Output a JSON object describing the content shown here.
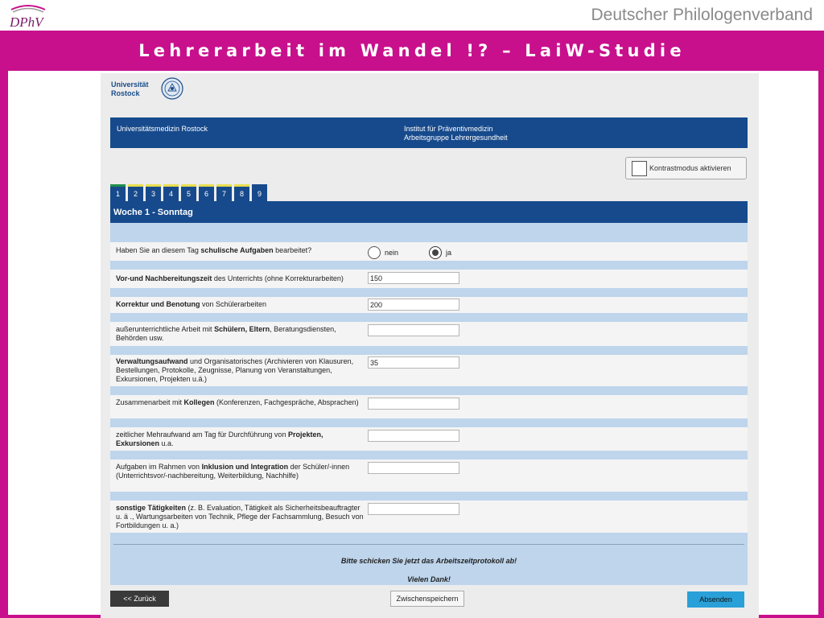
{
  "slide": {
    "logo_text": "DPhV",
    "org_name": "Deutscher Philologenverband",
    "title": "Lehrerarbeit im Wandel !? – LaiW-Studie",
    "colors": {
      "frame": "#c8108c",
      "navy": "#174a8c",
      "band": "#bed5ec",
      "send": "#2aa0d8"
    }
  },
  "header": {
    "university_line1": "Universität",
    "university_line2": "Rostock",
    "bar_left": "Universitätsmedizin Rostock",
    "bar_right_line1": "Institut für Präventivmedizin",
    "bar_right_line2": "Arbeitsgruppe Lehrergesundheit"
  },
  "contrast": {
    "label": "Kontrastmodus aktivieren"
  },
  "tabs": [
    {
      "label": "1",
      "state": "done"
    },
    {
      "label": "2",
      "state": "pending"
    },
    {
      "label": "3",
      "state": "pending"
    },
    {
      "label": "4",
      "state": "pending"
    },
    {
      "label": "5",
      "state": "pending"
    },
    {
      "label": "6",
      "state": "pending"
    },
    {
      "label": "7",
      "state": "pending"
    },
    {
      "label": "8",
      "state": "pending"
    },
    {
      "label": "9",
      "state": "none"
    }
  ],
  "week_title": "Woche 1 - Sonntag",
  "question": {
    "text_before": "Haben Sie an diesem Tag ",
    "text_bold": "schulische Aufgaben",
    "text_after": " bearbeitet?",
    "option_no": "nein",
    "option_yes": "ja",
    "selected": "ja"
  },
  "fields": [
    {
      "bold1": "Vor-und Nachbereitungszeit",
      "rest1": " des Unterrichts (ohne Korrekturarbeiten)",
      "value": "150"
    },
    {
      "bold1": "Korrektur und Benotung",
      "rest1": " von Schülerarbeiten",
      "value": "200"
    },
    {
      "pre": "außerunterrichtliche Arbeit mit ",
      "bold1": "Schülern, Eltern",
      "rest1": ", Beratungsdiensten, Behörden usw.",
      "value": ""
    },
    {
      "bold1": "Verwaltungsaufwand",
      "rest1": " und Organisatorisches (Archivieren von Klausuren, Bestellungen, Protokolle, Zeugnisse, Planung von Veranstaltungen, Exkursionen, Projekten u.ä.)",
      "value": "35"
    },
    {
      "pre": "Zusammenarbeit mit ",
      "bold1": "Kollegen",
      "rest1": " (Konferenzen, Fachgespräche, Absprachen)",
      "value": ""
    },
    {
      "pre": "zeitlicher Mehraufwand am Tag für Durchführung von ",
      "bold1": "Projekten, Exkursionen",
      "rest1": " u.a.",
      "value": ""
    },
    {
      "pre": "Aufgaben im Rahmen von ",
      "bold1": "Inklusion und Integration",
      "rest1": " der Schüler/-innen (Unterrichtsvor/-nachbereitung, Weiterbildung, Nachhilfe)",
      "value": ""
    },
    {
      "bold1": "sonstige Tätigkeiten",
      "rest1": " (z. B. Evaluation, Tätigkeit als Sicherheitsbeauftragter u. ä ., Wartungsarbeiten von Technik, Pflege der Fachsammlung, Besuch von Fortbildungen u. a.)",
      "value": ""
    }
  ],
  "closing": {
    "line1": "Bitte schicken Sie jetzt das Arbeitszeitprotokoll ab!",
    "line2": "Vielen Dank!"
  },
  "buttons": {
    "back": "<< Zurück",
    "save": "Zwischenspeichern",
    "send": "Absenden"
  }
}
